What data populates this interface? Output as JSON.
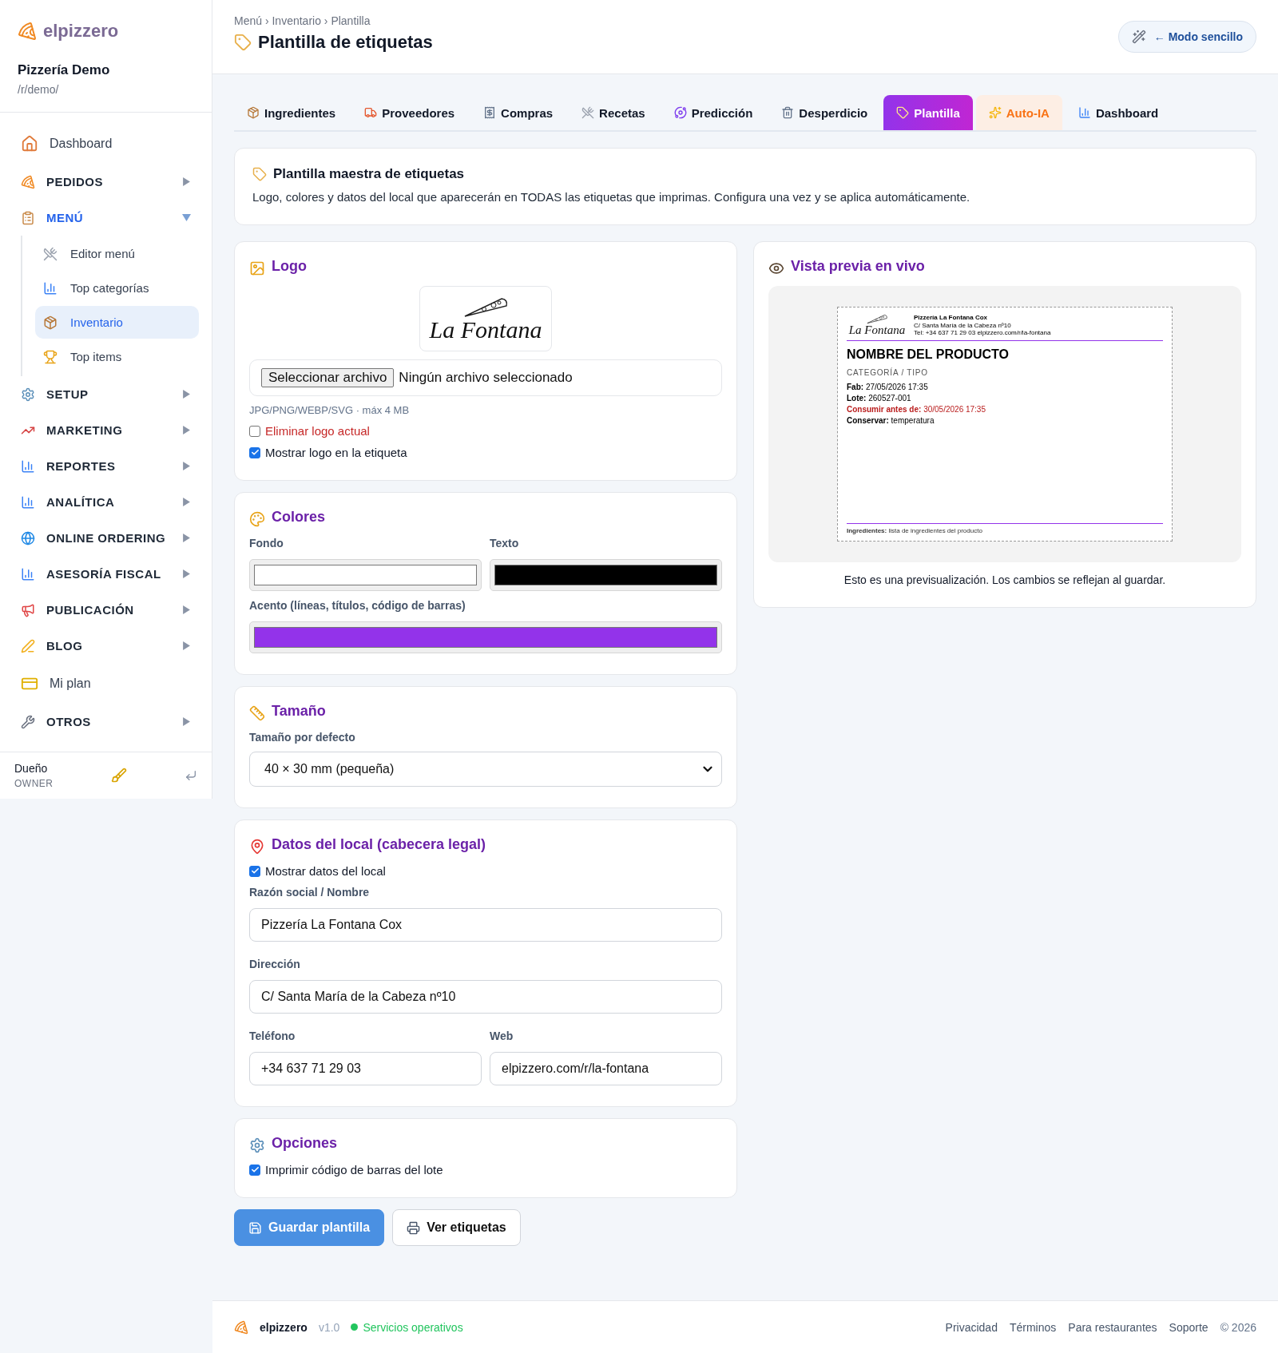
{
  "brand": "elpizzero",
  "restaurant": {
    "name": "Pizzería Demo",
    "path": "/r/demo/"
  },
  "sidebar": {
    "items": [
      {
        "kind": "link",
        "label": "Dashboard"
      },
      {
        "kind": "group",
        "label": "PEDIDOS",
        "expanded": false
      },
      {
        "kind": "group",
        "label": "MENÚ",
        "expanded": true,
        "children": [
          {
            "label": "Editor menú",
            "selected": false
          },
          {
            "label": "Top categorías",
            "selected": false
          },
          {
            "label": "Inventario",
            "selected": true
          },
          {
            "label": "Top items",
            "selected": false
          }
        ]
      },
      {
        "kind": "group",
        "label": "SETUP",
        "expanded": false
      },
      {
        "kind": "group",
        "label": "MARKETING",
        "expanded": false
      },
      {
        "kind": "group",
        "label": "REPORTES",
        "expanded": false
      },
      {
        "kind": "group",
        "label": "ANALÍTICA",
        "expanded": false
      },
      {
        "kind": "group",
        "label": "ONLINE ORDERING",
        "expanded": false
      },
      {
        "kind": "group",
        "label": "ASESORÍA FISCAL",
        "expanded": false
      },
      {
        "kind": "group",
        "label": "PUBLICACIÓN",
        "expanded": false
      },
      {
        "kind": "group",
        "label": "BLOG",
        "expanded": false
      },
      {
        "kind": "link",
        "label": "Mi plan"
      },
      {
        "kind": "group",
        "label": "OTROS",
        "expanded": false
      }
    ]
  },
  "user": {
    "name": "Dueño",
    "role": "OWNER"
  },
  "breadcrumb": "Menú › Inventario › Plantilla",
  "page_title": "Plantilla de etiquetas",
  "mode_button": "← Modo sencillo",
  "tabs": [
    {
      "label": "Ingredientes",
      "selected": false,
      "kind": "normal"
    },
    {
      "label": "Proveedores",
      "selected": false,
      "kind": "normal"
    },
    {
      "label": "Compras",
      "selected": false,
      "kind": "normal"
    },
    {
      "label": "Recetas",
      "selected": false,
      "kind": "normal"
    },
    {
      "label": "Predicción",
      "selected": false,
      "kind": "normal"
    },
    {
      "label": "Desperdicio",
      "selected": false,
      "kind": "normal"
    },
    {
      "label": "Plantilla",
      "selected": true,
      "kind": "normal"
    },
    {
      "label": "Auto-IA",
      "selected": false,
      "kind": "ai"
    },
    {
      "label": "Dashboard",
      "selected": false,
      "kind": "normal"
    }
  ],
  "intro": {
    "title": "Plantilla maestra de etiquetas",
    "text": "Logo, colores y datos del local que aparecerán en TODAS las etiquetas que imprimas. Configura una vez y se aplica automáticamente."
  },
  "logo_section": {
    "title": "Logo",
    "logo_text": "La Fontana",
    "file_button": "Seleccionar archivo",
    "file_status": "Ningún archivo seleccionado",
    "hint": "JPG/PNG/WEBP/SVG · máx 4 MB",
    "remove": {
      "label": "Eliminar logo actual",
      "checked": false
    },
    "show": {
      "label": "Mostrar logo en la etiqueta",
      "checked": true
    }
  },
  "colors_section": {
    "title": "Colores",
    "fields": [
      {
        "label": "Fondo",
        "color": "#ffffff"
      },
      {
        "label": "Texto",
        "color": "#000000"
      },
      {
        "label": "Acento (líneas, títulos, código de barras)",
        "color": "#9333ea"
      }
    ]
  },
  "size_section": {
    "title": "Tamaño",
    "label": "Tamaño por defecto",
    "value": "40 × 30 mm (pequeña)"
  },
  "local_section": {
    "title": "Datos del local (cabecera legal)",
    "show": {
      "label": "Mostrar datos del local",
      "checked": true
    },
    "fields": [
      {
        "label": "Razón social / Nombre",
        "value": "Pizzería La Fontana Cox"
      },
      {
        "label": "Dirección",
        "value": "C/ Santa María de la Cabeza nº10"
      },
      {
        "label": "Teléfono",
        "value": "+34 637 71 29 03"
      },
      {
        "label": "Web",
        "value": "elpizzero.com/r/la-fontana"
      }
    ]
  },
  "options_section": {
    "title": "Opciones",
    "barcode": {
      "label": "Imprimir código de barras del lote",
      "checked": true
    }
  },
  "buttons": [
    {
      "label": "Guardar plantilla",
      "kind": "primary"
    },
    {
      "label": "Ver etiquetas",
      "kind": "secondary"
    }
  ],
  "preview": {
    "title": "Vista previa en vivo",
    "label": {
      "logo_text": "La Fontana",
      "name": "Pizzería La Fontana Cox",
      "address": "C/ Santa María de la Cabeza nº10",
      "contact": "Tel: +34 637 71 29 03 elpizzero.com/r/la-fontana",
      "product": "NOMBRE DEL PRODUCTO",
      "category": "CATEGORÍA / TIPO",
      "lines": [
        {
          "label": "Fab:",
          "value": "27/05/2026 17:35",
          "kind": "normal"
        },
        {
          "label": "Lote:",
          "value": "260527-001",
          "kind": "normal"
        },
        {
          "label": "Consumir antes de:",
          "value": "30/05/2026 17:35",
          "kind": "warning"
        },
        {
          "label": "Conservar:",
          "value": "temperatura",
          "kind": "normal"
        }
      ],
      "ingredients_label": "Ingredientes:",
      "ingredients": "lista de ingredientes del producto"
    },
    "note": "Esto es una previsualización. Los cambios se reflejan al guardar."
  },
  "footer": {
    "brand": "elpizzero",
    "version": "v1.0",
    "status": "Servicios operativos",
    "links": [
      "Privacidad",
      "Términos",
      "Para restaurantes",
      "Soporte"
    ],
    "copyright": "© 2026"
  }
}
